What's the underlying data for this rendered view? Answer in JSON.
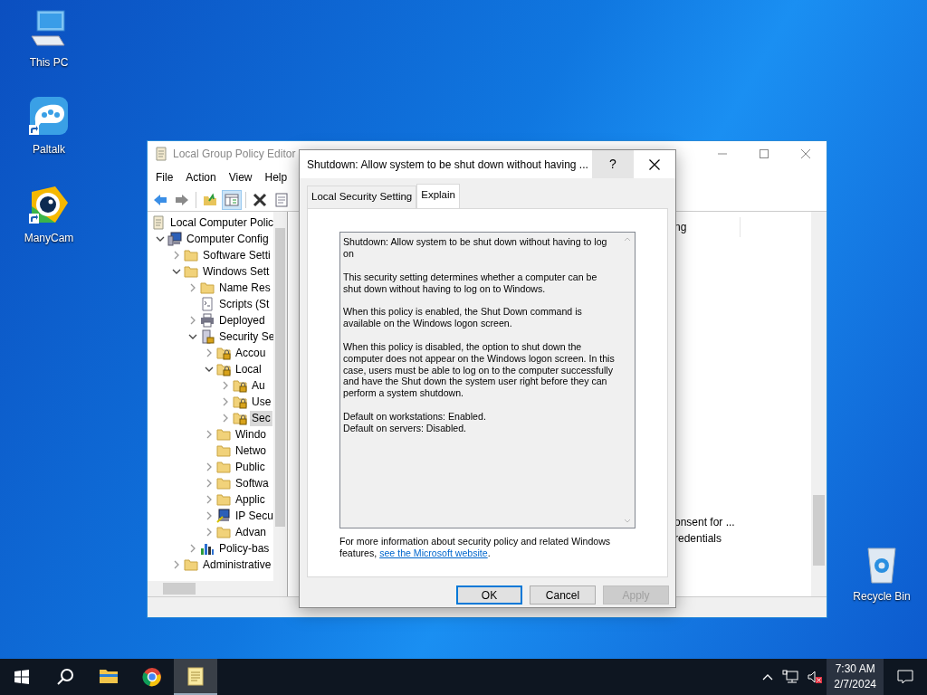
{
  "desktop_icons": [
    {
      "label": "This PC",
      "kind": "computer",
      "shortcut": false
    },
    {
      "label": "Paltalk",
      "kind": "chat",
      "shortcut": true
    },
    {
      "label": "ManyCam",
      "kind": "camera",
      "shortcut": true
    },
    {
      "label": "Recycle Bin",
      "kind": "bin",
      "shortcut": false
    }
  ],
  "editor": {
    "title": "Local Group Policy Editor",
    "menu": [
      "File",
      "Action",
      "View",
      "Help"
    ],
    "tree": [
      {
        "label": "Local Computer Polic",
        "kind": "scroll",
        "selected": false,
        "children": [
          {
            "label": "Computer Config",
            "kind": "computer",
            "expanded": true,
            "selected": false,
            "children": [
              {
                "label": "Software Setti",
                "kind": "folder",
                "expanded": false,
                "selected": false
              },
              {
                "label": "Windows Sett",
                "kind": "folder",
                "expanded": true,
                "selected": false,
                "children": [
                  {
                    "label": "Name Res",
                    "kind": "folder",
                    "expanded": false,
                    "selected": false
                  },
                  {
                    "label": "Scripts (St",
                    "kind": "script",
                    "selected": false
                  },
                  {
                    "label": "Deployed",
                    "kind": "printer",
                    "expanded": false,
                    "selected": false
                  },
                  {
                    "label": "Security Se",
                    "kind": "security",
                    "expanded": true,
                    "selected": false,
                    "children": [
                      {
                        "label": "Accou",
                        "kind": "locked-folder",
                        "expanded": false,
                        "selected": false
                      },
                      {
                        "label": "Local",
                        "kind": "locked-folder",
                        "expanded": true,
                        "selected": false,
                        "children": [
                          {
                            "label": "Au",
                            "kind": "locked-folder",
                            "expanded": false,
                            "selected": false
                          },
                          {
                            "label": "Use",
                            "kind": "locked-folder",
                            "expanded": false,
                            "selected": false
                          },
                          {
                            "label": "Sec",
                            "kind": "locked-folder",
                            "expanded": false,
                            "selected": true
                          }
                        ]
                      },
                      {
                        "label": "Windo",
                        "kind": "folder",
                        "expanded": false,
                        "selected": false
                      },
                      {
                        "label": "Netwo",
                        "kind": "folder",
                        "selected": false
                      },
                      {
                        "label": "Public",
                        "kind": "folder",
                        "expanded": false,
                        "selected": false
                      },
                      {
                        "label": "Softwa",
                        "kind": "folder",
                        "expanded": false,
                        "selected": false
                      },
                      {
                        "label": "Applic",
                        "kind": "folder",
                        "expanded": false,
                        "selected": false
                      },
                      {
                        "label": "IP Secu",
                        "kind": "network",
                        "expanded": false,
                        "selected": false
                      },
                      {
                        "label": "Advan",
                        "kind": "folder",
                        "expanded": false,
                        "selected": false
                      }
                    ]
                  },
                  {
                    "label": "Policy-bas",
                    "kind": "chart",
                    "expanded": false,
                    "selected": false
                  }
                ]
              },
              {
                "label": "Administrative",
                "kind": "folder",
                "expanded": false,
                "selected": false
              }
            ]
          }
        ]
      }
    ],
    "details": {
      "column_header": "ng",
      "rows": [
        "onsent for ...",
        "redentials"
      ]
    }
  },
  "dialog": {
    "title": "Shutdown: Allow system to be shut down without having ...",
    "help": "?",
    "tabs": [
      {
        "label": "Local Security Setting",
        "selected": false
      },
      {
        "label": "Explain",
        "selected": true
      }
    ],
    "explain": [
      "Shutdown: Allow system to be shut down without having to log on",
      "This security setting determines whether a computer can be shut down without having to log on to Windows.",
      "When this policy is enabled, the Shut Down command is available on the Windows logon screen.",
      "When this policy is disabled, the option to shut down the computer does not appear on the Windows logon screen. In this case, users must be able to log on to the computer successfully and have the Shut down the system user right before they can perform a system shutdown.",
      "Default on workstations: Enabled.\nDefault on servers: Disabled."
    ],
    "footer_text": "For more information about security policy and related Windows features, ",
    "footer_link": "see the Microsoft website",
    "footer_end": ".",
    "buttons": [
      {
        "label": "OK",
        "default": true,
        "disabled": false
      },
      {
        "label": "Cancel",
        "default": false,
        "disabled": false
      },
      {
        "label": "Apply",
        "default": false,
        "disabled": true
      }
    ]
  },
  "taskbar": {
    "apps": [
      {
        "kind": "files",
        "active": false
      },
      {
        "kind": "browser",
        "active": false
      },
      {
        "kind": "notepad",
        "active": true
      }
    ],
    "time": "7:30 AM",
    "date": "2/7/2024"
  }
}
